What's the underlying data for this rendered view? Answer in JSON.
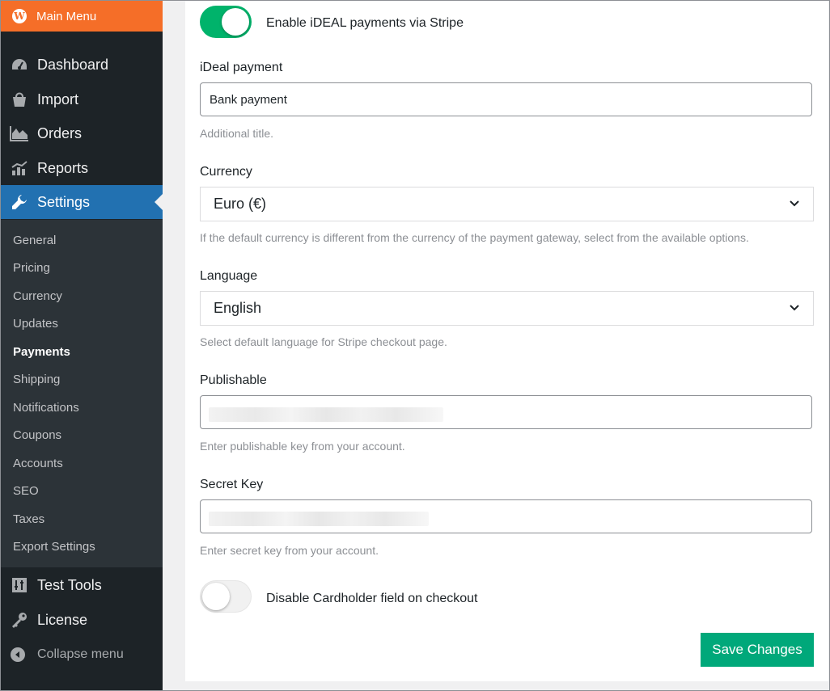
{
  "sidebar": {
    "main_menu": {
      "label": "Main Menu",
      "icon": "wordpress-icon"
    },
    "items": [
      {
        "label": "Dashboard",
        "icon": "dashboard-icon"
      },
      {
        "label": "Import",
        "icon": "import-icon"
      },
      {
        "label": "Orders",
        "icon": "orders-icon"
      },
      {
        "label": "Reports",
        "icon": "reports-icon"
      },
      {
        "label": "Settings",
        "icon": "wrench-icon",
        "active": true
      }
    ],
    "submenu": [
      "General",
      "Pricing",
      "Currency",
      "Updates",
      "Payments",
      "Shipping",
      "Notifications",
      "Coupons",
      "Accounts",
      "SEO",
      "Taxes",
      "Export Settings"
    ],
    "submenu_current": "Payments",
    "bottom_items": [
      {
        "label": "Test Tools",
        "icon": "tools-icon"
      },
      {
        "label": "License",
        "icon": "key-icon"
      }
    ],
    "collapse_label": "Collapse menu"
  },
  "form": {
    "enable_toggle": {
      "label": "Enable iDEAL payments via Stripe",
      "on": true
    },
    "title_field": {
      "label": "iDeal payment",
      "value": "Bank payment",
      "help": "Additional title."
    },
    "currency_field": {
      "label": "Currency",
      "value": "Euro (€)",
      "help": "If the default currency is different from the currency of the payment gateway, select from the available options."
    },
    "language_field": {
      "label": "Language",
      "value": "English",
      "help": "Select default language for Stripe checkout page."
    },
    "publishable_field": {
      "label": "Publishable",
      "help": "Enter publishable key from your account."
    },
    "secret_field": {
      "label": "Secret Key",
      "help": "Enter secret key from your account."
    },
    "cardholder_toggle": {
      "label": "Disable Cardholder field on checkout",
      "on": false
    },
    "save_label": "Save Changes"
  },
  "colors": {
    "sidebar_bg": "#1d2327",
    "menu_top": "#f56e28",
    "active_item": "#2271b1",
    "toggle_on": "#00b36b",
    "save_button": "#00a87a"
  }
}
